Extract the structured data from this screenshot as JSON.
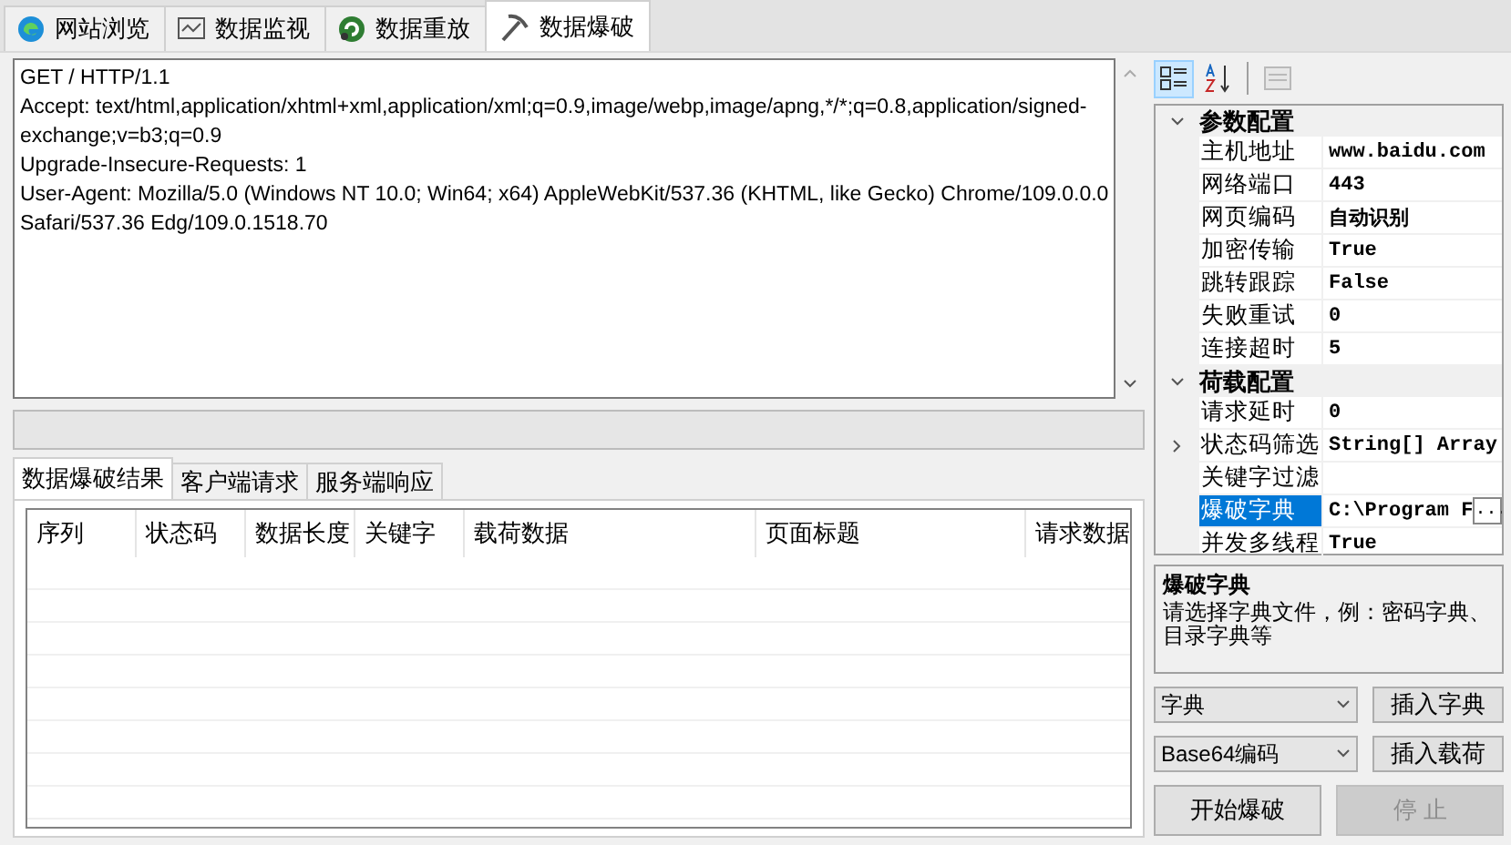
{
  "tabs": [
    {
      "label": "网站浏览",
      "selected": false
    },
    {
      "label": "数据监视",
      "selected": false
    },
    {
      "label": "数据重放",
      "selected": false
    },
    {
      "label": "数据爆破",
      "selected": true
    }
  ],
  "request_lines": [
    "GET / HTTP/1.1",
    "Accept: text/html,application/xhtml+xml,application/xml;q=0.9,image/webp,image/apng,*/*;q=0.8,application/signed-",
    "exchange;v=b3;q=0.9",
    "Upgrade-Insecure-Requests: 1",
    "User-Agent: Mozilla/5.0 (Windows NT 10.0; Win64; x64) AppleWebKit/537.36 (KHTML, like Gecko) Chrome/109.0.0.0",
    "Safari/537.36 Edg/109.0.1518.70"
  ],
  "progress": {
    "level": 0
  },
  "result_tabs": [
    {
      "label": "数据爆破结果",
      "selected": true
    },
    {
      "label": "客户端请求",
      "selected": false
    },
    {
      "label": "服务端响应",
      "selected": false
    }
  ],
  "table": {
    "columns": [
      "序列",
      "状态码",
      "数据长度",
      "关键字",
      "载荷数据",
      "页面标题",
      "请求数据"
    ]
  },
  "toolbar": [
    {
      "kind": "categorized",
      "selected": true,
      "disabled": false
    },
    {
      "kind": "alphabetical",
      "selected": false,
      "disabled": false
    },
    {
      "kind": "pages",
      "selected": false,
      "disabled": true
    }
  ],
  "property_grid": [
    {
      "category": "参数配置",
      "expanded": true,
      "items": [
        {
          "name": "主机地址",
          "value": "www.baidu.com",
          "kind": "plain",
          "selected": false
        },
        {
          "name": "网络端口",
          "value": "443",
          "kind": "plain",
          "selected": false
        },
        {
          "name": "网页编码",
          "value": "自动识别",
          "kind": "plain",
          "selected": false
        },
        {
          "name": "加密传输",
          "value": "True",
          "kind": "plain",
          "selected": false
        },
        {
          "name": "跳转跟踪",
          "value": "False",
          "kind": "plain",
          "selected": false
        },
        {
          "name": "失败重试",
          "value": "0",
          "kind": "plain",
          "selected": false
        },
        {
          "name": "连接超时",
          "value": "5",
          "kind": "plain",
          "selected": false
        }
      ]
    },
    {
      "category": "荷载配置",
      "expanded": true,
      "items": [
        {
          "name": "请求延时",
          "value": "0",
          "kind": "plain",
          "selected": false
        },
        {
          "name": "状态码筛选",
          "value": "String[] Array",
          "kind": "collection",
          "selected": false
        },
        {
          "name": "关键字过滤",
          "value": "",
          "kind": "plain",
          "selected": false
        },
        {
          "name": "爆破字典",
          "value": "C:\\Program F",
          "kind": "file",
          "button": "...",
          "selected": true
        },
        {
          "name": "并发多线程",
          "value": "True",
          "kind": "plain",
          "selected": false
        }
      ]
    }
  ],
  "description": {
    "title": "爆破字典",
    "text": "请选择字典文件，例：密码字典、目录字典等"
  },
  "controls": [
    {
      "dropdown": "字典",
      "button": "插入字典"
    },
    {
      "dropdown": "Base64编码",
      "button": "插入载荷"
    }
  ],
  "actions": [
    {
      "label": "开始爆破",
      "disabled": false
    },
    {
      "label": "停 止",
      "disabled": true
    }
  ]
}
